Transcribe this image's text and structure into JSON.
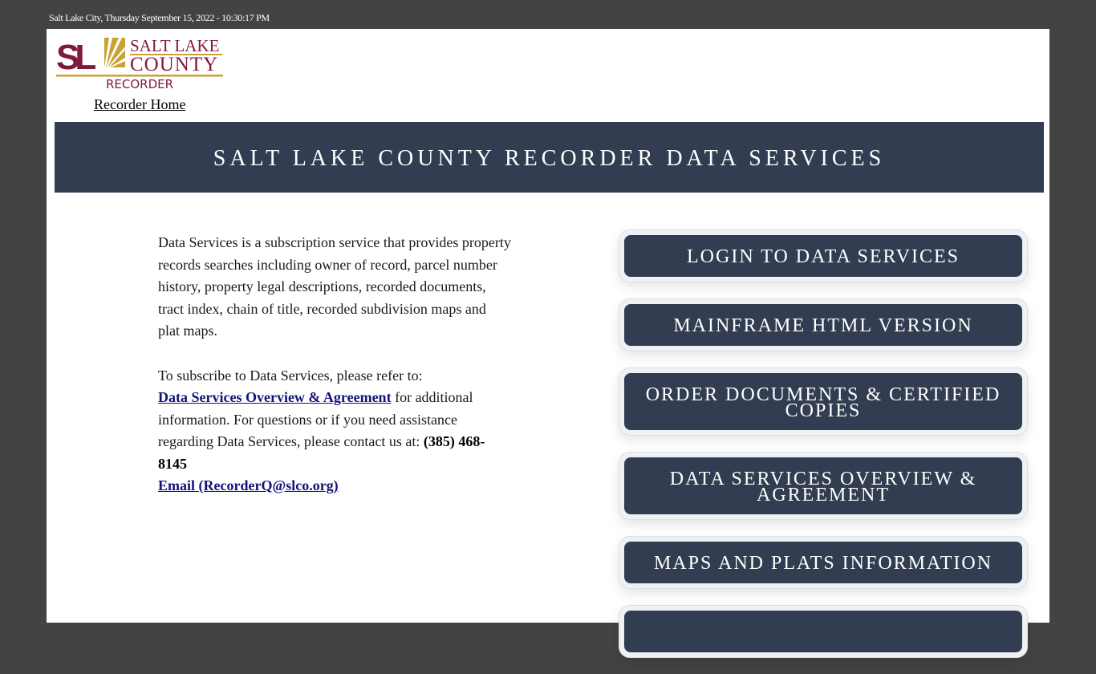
{
  "topbar": {
    "datetime": "Salt Lake City, Thursday September 15, 2022 - 10:30:17 PM"
  },
  "logo": {
    "initials": "SL",
    "line1": "SALT LAKE",
    "line2": "COUNTY",
    "line3": "RECORDER",
    "colors": {
      "maroon": "#7d1a3f",
      "gold": "#c9a233"
    }
  },
  "nav": {
    "home_link": "Recorder Home"
  },
  "banner": {
    "title": "SALT LAKE COUNTY RECORDER DATA SERVICES"
  },
  "content": {
    "intro": "Data Services is a subscription service that provides property records searches including owner of record, parcel number history, property legal descriptions, recorded documents, tract index, chain of title, recorded subdivision maps and plat maps.",
    "subscribe_lead": "To subscribe to Data Services, please refer to:",
    "agreement_link": "Data Services Overview & Agreement",
    "after_link": " for additional information. For questions or if you need assistance regarding Data Services, please contact us at: ",
    "phone": "(385) 468-8145",
    "email_link": "Email (RecorderQ@slco.org)"
  },
  "buttons": [
    {
      "label": "LOGIN TO DATA SERVICES"
    },
    {
      "label": "MAINFRAME HTML VERSION"
    },
    {
      "label": "ORDER DOCUMENTS & CERTIFIED COPIES"
    },
    {
      "label": "DATA SERVICES OVERVIEW & AGREEMENT"
    },
    {
      "label": "MAPS AND PLATS INFORMATION"
    },
    {
      "label": ""
    }
  ],
  "colors": {
    "page_bg": "#434343",
    "navy": "#323d52",
    "link": "#13137a"
  }
}
